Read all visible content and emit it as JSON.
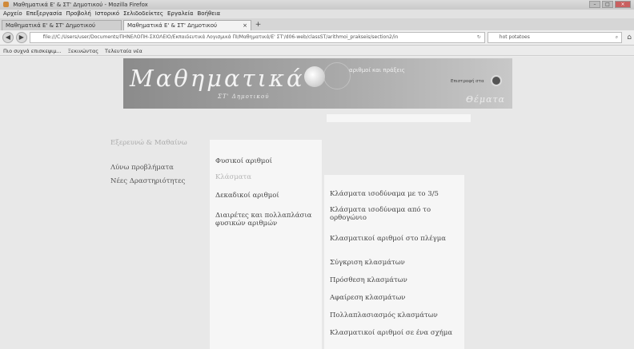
{
  "browser": {
    "window_title": "Μαθηματικά Ε' & ΣΤ' Δημοτικού - Mozilla Firefox",
    "menu": [
      "Αρχείο",
      "Επεξεργασία",
      "Προβολή",
      "Ιστορικό",
      "Σελιδοδείκτες",
      "Εργαλεία",
      "Βοήθεια"
    ],
    "tabs": [
      {
        "label": "Μαθηματικά Ε' & ΣΤ' Δημοτικού"
      },
      {
        "label": "Μαθηματικά Ε' & ΣΤ' Δημοτικού",
        "close": "×"
      }
    ],
    "new_tab": "+",
    "url": "file:///C:/Users/user/Documents/ΠΗΝΕΛΟΠΗ-ΣΧΟΛΕΙΟ/Εκπαιδευτικά Λογισμικά ΠΙ/Μαθηματικά/Ε' ΣΤ'/d06-web/classST/arithmoi_prakseis/section2/in",
    "search_value": "hot potatoes",
    "bookmarks": [
      "Πιο συχνά επισκεψιμ...",
      "Ξεκινώντας",
      "Τελευταία νέα"
    ]
  },
  "banner": {
    "title": "Μαθηματικά",
    "subtitle": "ΣΤ' Δημοτικού",
    "caption": "αριθμοί και πράξεις",
    "right_label": "Επιστροφή στα",
    "themata": "Θέματα"
  },
  "left_nav": [
    {
      "label": "Εξερευνώ & Μαθαίνω"
    },
    {
      "label": "Λύνω προβλήματα"
    },
    {
      "label": "Νέες Δραστηριότητες"
    }
  ],
  "mid_nav": [
    {
      "label": "Φυσικοί αριθμοί"
    },
    {
      "label": "Κλάσματα"
    },
    {
      "label": "Δεκαδικοί αριθμοί"
    },
    {
      "label": "Διαιρέτες και πολλαπλάσια φυσικών αριθμών"
    }
  ],
  "right_nav": [
    {
      "label": "Κλάσματα ισοδύναμα με το 3/5"
    },
    {
      "label": "Κλάσματα ισοδύναμα από το ορθογώνιο"
    },
    {
      "label": "Κλασματικοί αριθμοί στο πλέγμα"
    },
    {
      "label": "Σύγκριση κλασμάτων"
    },
    {
      "label": "Πρόσθεση κλασμάτων"
    },
    {
      "label": "Αφαίρεση κλασμάτων"
    },
    {
      "label": "Πολλαπλασιασμός κλασμάτων"
    },
    {
      "label": "Κλασματικοί αριθμοί σε ένα σχήμα"
    }
  ]
}
